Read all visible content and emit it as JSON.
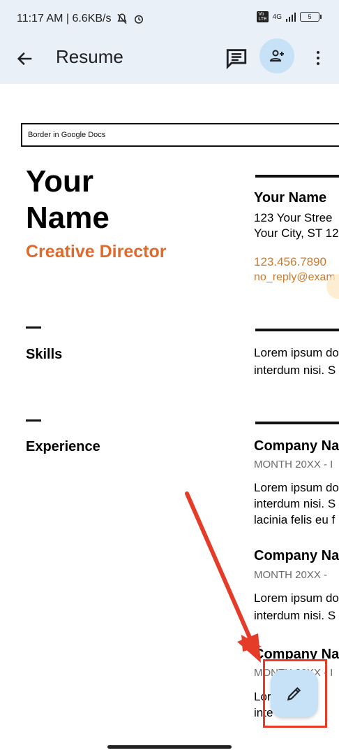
{
  "status": {
    "time_speed": "11:17 AM | 6.6KB/s",
    "network": "4G",
    "battery": "5"
  },
  "appbar": {
    "title": "Resume"
  },
  "document": {
    "border_label": "Border in Google Docs",
    "name_line1": "Your",
    "name_line2": "Name",
    "role": "Creative Director",
    "contact_name": "Your Name",
    "street": "123 Your Stree",
    "city": "Your City, ST 12",
    "phone": "123.456.7890",
    "email": "no_reply@exam",
    "skills_label": "Skills",
    "skills_text1": "Lorem ipsum do",
    "skills_text2": "interdum nisi. S",
    "experience_label": "Experience",
    "jobs": [
      {
        "company": "Company Nam",
        "date": "MONTH 20XX - I",
        "l1": "Lorem ipsum do",
        "l2": "interdum nisi. S",
        "l3": "lacinia felis eu f"
      },
      {
        "company": "Company Nam",
        "date": "MONTH 20XX -",
        "l1": "Lorem ipsum do",
        "l2": "interdum nisi. S"
      },
      {
        "company": "Company Nam",
        "date": "MONTH 20XX - I",
        "l1": "Lor",
        "l2": "inte"
      }
    ]
  },
  "colors": {
    "accent_orange": "#e0692c",
    "fab_bg": "#c7e2f6",
    "annotation_red": "#e53c2a"
  },
  "icons": {
    "back": "arrow-left-icon",
    "comment": "comment-icon",
    "share": "person-add-icon",
    "more": "more-vert-icon",
    "edit": "pencil-icon"
  }
}
